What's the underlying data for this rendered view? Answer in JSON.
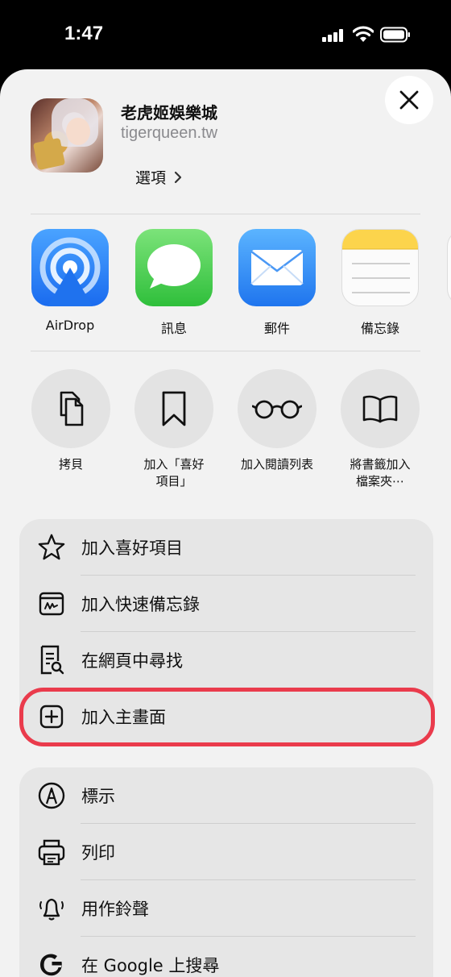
{
  "status_bar": {
    "time": "1:47"
  },
  "header": {
    "site_title": "老虎姬娛樂城",
    "site_url": "tigerqueen.tw",
    "options_label": "選項"
  },
  "share_targets": [
    {
      "label": "AirDrop",
      "icon": "airdrop-icon"
    },
    {
      "label": "訊息",
      "icon": "messages-icon"
    },
    {
      "label": "郵件",
      "icon": "mail-icon"
    },
    {
      "label": "備忘錄",
      "icon": "notes-icon"
    }
  ],
  "quick_actions": [
    {
      "label": "拷貝",
      "icon": "copy-icon"
    },
    {
      "label": "加入「喜好\n項目」",
      "icon": "bookmark-icon"
    },
    {
      "label": "加入閱讀列表",
      "icon": "glasses-icon"
    },
    {
      "label": "將書籤加入\n檔案夾⋯",
      "icon": "book-icon"
    }
  ],
  "menu_group_1": [
    {
      "label": "加入喜好項目",
      "icon": "star-icon"
    },
    {
      "label": "加入快速備忘錄",
      "icon": "quick-note-icon"
    },
    {
      "label": "在網頁中尋找",
      "icon": "find-on-page-icon"
    },
    {
      "label": "加入主畫面",
      "icon": "add-square-icon"
    }
  ],
  "menu_group_2": [
    {
      "label": "標示",
      "icon": "markup-icon"
    },
    {
      "label": "列印",
      "icon": "printer-icon"
    },
    {
      "label": "用作鈴聲",
      "icon": "bell-icon"
    },
    {
      "label": "在 Google 上搜尋",
      "icon": "google-icon"
    }
  ],
  "colors": {
    "highlight": "#ea3b4c",
    "sheet_bg": "#f2f2f2",
    "card_bg": "#e6e6e6"
  }
}
